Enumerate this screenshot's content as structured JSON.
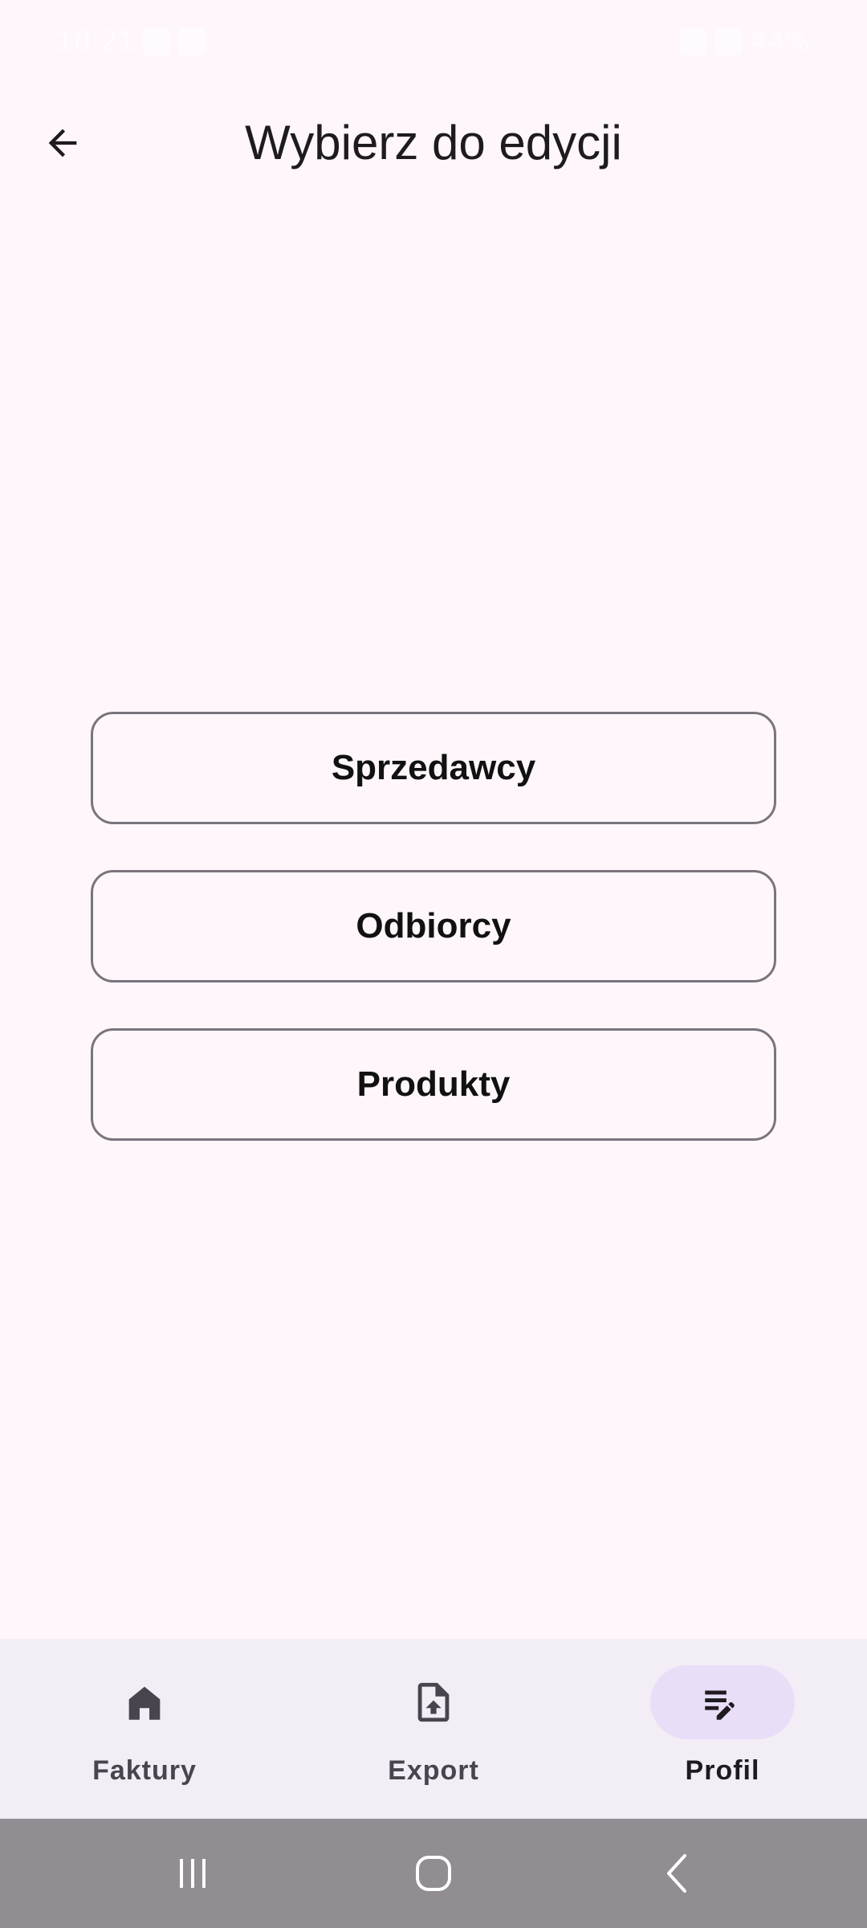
{
  "status_bar": {
    "time": "10:21",
    "battery": "44%"
  },
  "app_bar": {
    "title": "Wybierz do edycji",
    "back_icon": "arrow-back-icon"
  },
  "options": [
    {
      "label": "Sprzedawcy"
    },
    {
      "label": "Odbiorcy"
    },
    {
      "label": "Produkty"
    }
  ],
  "bottom_nav": {
    "items": [
      {
        "label": "Faktury",
        "icon": "home-icon",
        "selected": false
      },
      {
        "label": "Export",
        "icon": "file-upload-icon",
        "selected": false
      },
      {
        "label": "Profil",
        "icon": "edit-note-icon",
        "selected": true
      }
    ]
  },
  "colors": {
    "background": "#fef6fb",
    "nav_background": "#f3edf6",
    "selected_indicator": "#e8def8",
    "outline": "#79747e",
    "system_nav": "#918d93"
  }
}
